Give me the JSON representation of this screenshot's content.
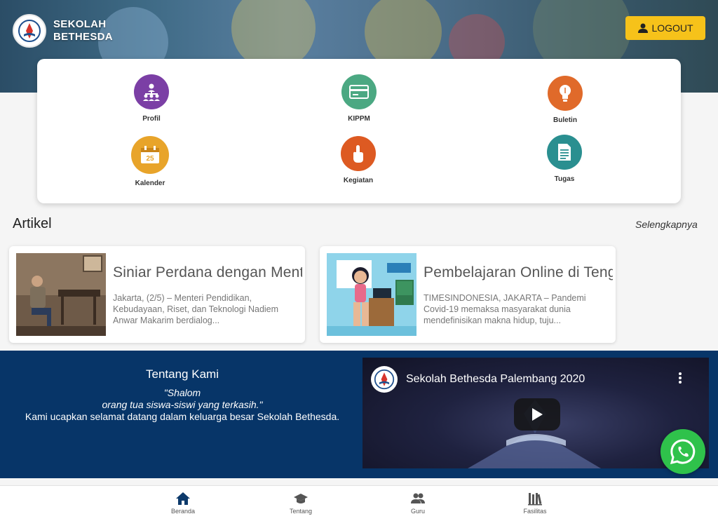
{
  "header": {
    "logo_line1": "SEKOLAH",
    "logo_line2": "BETHESDA",
    "logout_label": "LOGOUT",
    "logout_color": "#f6c21a"
  },
  "menu": [
    {
      "label": "Profil",
      "icon": "org-chart-icon",
      "color": "#7b3fa5"
    },
    {
      "label": "KIPPM",
      "icon": "card-icon",
      "color": "#4ba882"
    },
    {
      "label": "Buletin",
      "icon": "lightbulb-icon",
      "color": "#e06a2a"
    },
    {
      "label": "Kalender",
      "icon": "calendar-icon",
      "color": "#e8a42a"
    },
    {
      "label": "Kegiatan",
      "icon": "hand-icon",
      "color": "#dd5a22"
    },
    {
      "label": "Tugas",
      "icon": "document-icon",
      "color": "#2a8f90"
    }
  ],
  "artikel": {
    "title": "Artikel",
    "see_more": "Selengkapnya",
    "items": [
      {
        "title": "Siniar Perdana dengan Menteri",
        "desc": "Jakarta, (2/5) – Menteri Pendidikan, Kebudayaan, Riset, dan Teknologi Nadiem Anwar Makarim berdialog..."
      },
      {
        "title": "Pembelajaran Online di Tengah",
        "desc": "TIMESINDONESIA, JAKARTA – Pandemi Covid-19 memaksa masyarakat dunia mendefinisikan makna hidup, tuju..."
      }
    ]
  },
  "about": {
    "title": "Tentang Kami",
    "quote_line1": "\"Shalom",
    "quote_line2": "orang tua siswa-siswi yang terkasih.\"",
    "welcome": "Kami ucapkan selamat datang dalam keluarga besar Sekolah Bethesda.",
    "bg_color": "#073568"
  },
  "video": {
    "title": "Sekolah Bethesda Palembang 2020"
  },
  "bottom_nav": [
    {
      "label": "Beranda",
      "icon": "home-icon",
      "active": true
    },
    {
      "label": "Tentang",
      "icon": "graduation-cap-icon"
    },
    {
      "label": "Guru",
      "icon": "users-icon"
    },
    {
      "label": "Fasilitas",
      "icon": "library-icon"
    }
  ]
}
